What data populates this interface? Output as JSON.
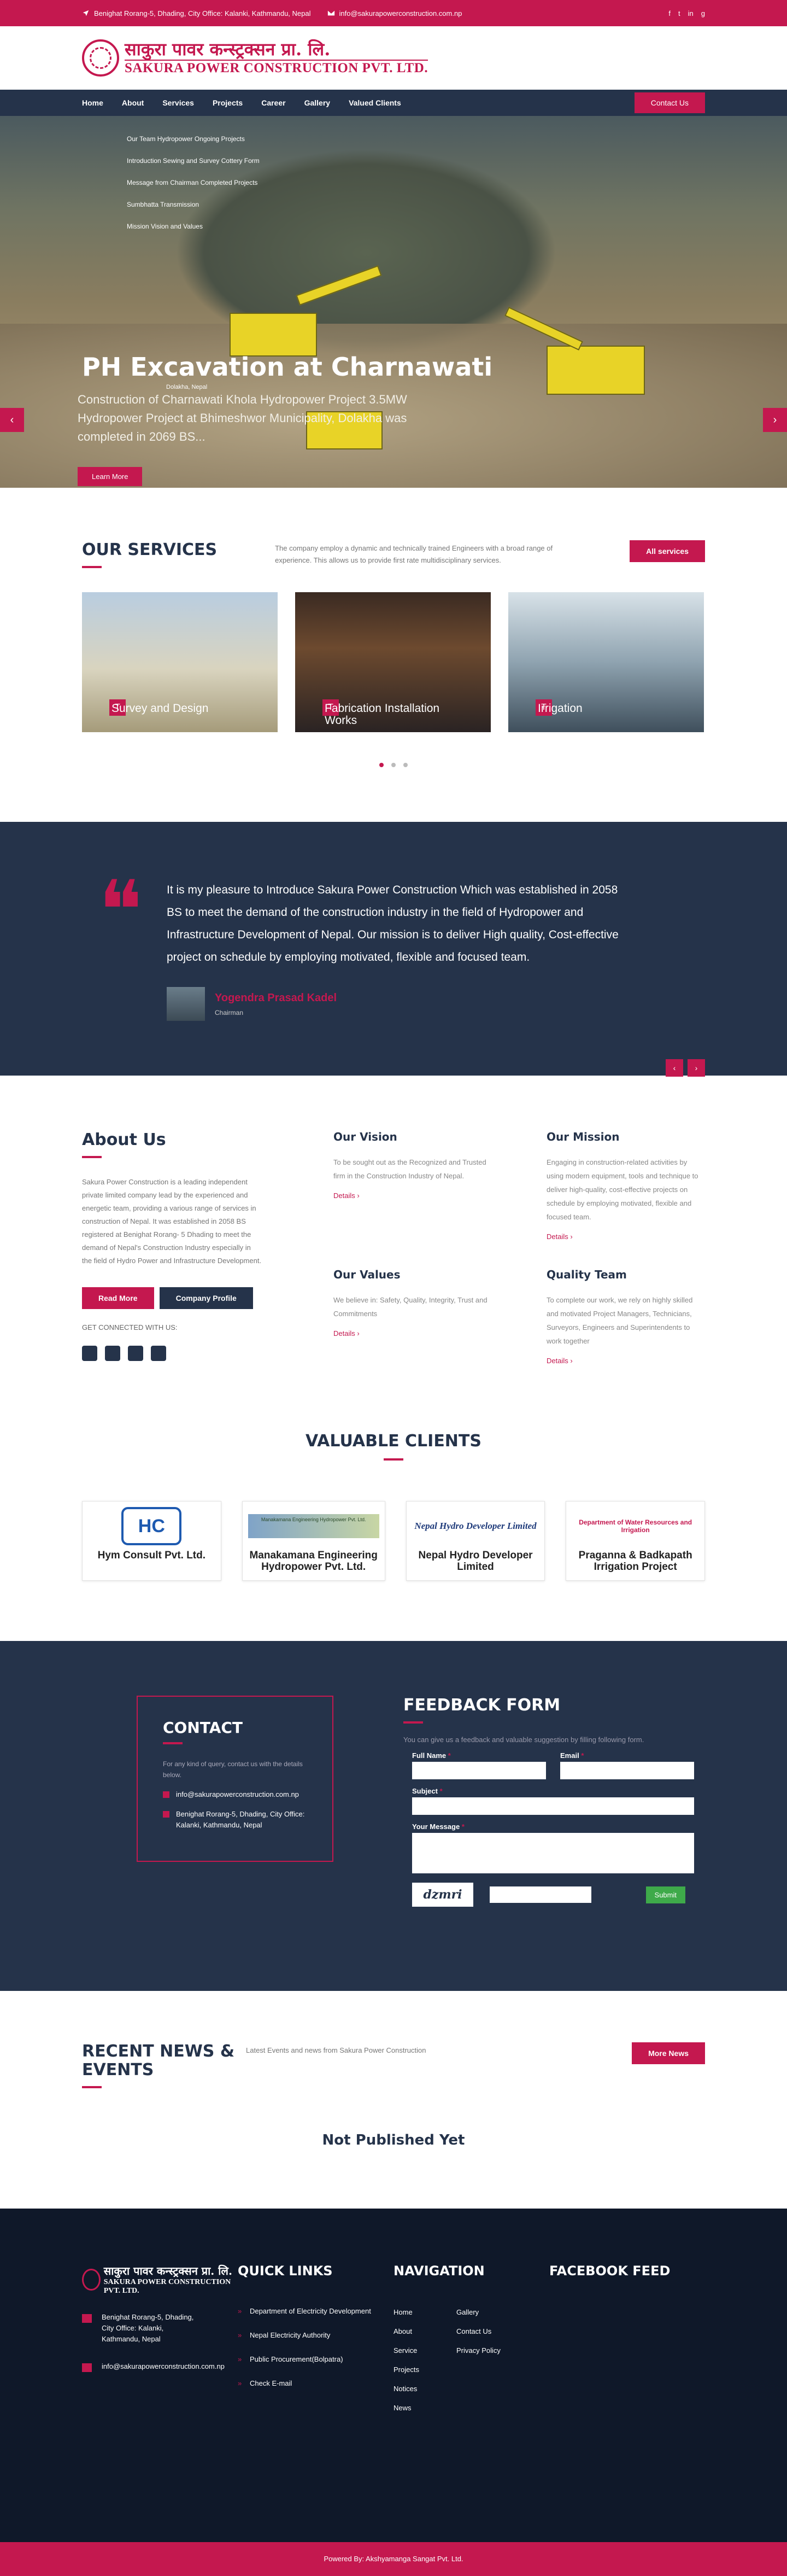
{
  "topbar": {
    "address": "Benighat Rorang-5, Dhading, City Office: Kalanki, Kathmandu, Nepal",
    "email": "info@sakurapowerconstruction.com.np",
    "social": [
      "f",
      "t",
      "in",
      "g"
    ]
  },
  "logo": {
    "nepali": "साकुरा पावर कन्स्ट्रक्सन प्रा. लि.",
    "english": "SAKURA POWER CONSTRUCTION PVT. LTD."
  },
  "nav": {
    "items": [
      "Home",
      "About",
      "Services",
      "Projects",
      "Career",
      "Gallery",
      "Valued Clients"
    ],
    "contact": "Contact Us"
  },
  "hero_menu": [
    "Our Team    Hydropower    Ongoing Projects",
    "Introduction Sewing and Survey    Cottery Form",
    "Message from Chairman    Completed Projects",
    "Sumbhatta    Transmission",
    "Mission Vision and Values"
  ],
  "hero": {
    "title": "PH Excavation at Charnawati",
    "subtitle_small": "Dolakha, Nepal",
    "text": "Construction of Charnawati Khola Hydropower Project 3.5MW Hydropower Project at Bhimeshwor Municipality, Dolakha was completed in 2069 BS...",
    "button": "Learn More"
  },
  "services": {
    "title": "OUR SERVICES",
    "desc": "The company employ a dynamic and technically trained Engineers with a broad range of experience. This allows us to provide first rate multidisciplinary services.",
    "button": "All services",
    "items": [
      {
        "label": "Survey and Design"
      },
      {
        "label": "Fabrication Installation Works"
      },
      {
        "label": "Irrigation"
      }
    ]
  },
  "quote": {
    "text": "It is my pleasure to Introduce Sakura Power Construction Which was established in 2058 BS to meet the demand of the construction industry in the field of Hydropower and Infrastructure Development of Nepal. Our mission is to deliver High quality, Cost-effective project on schedule by employing motivated, flexible and focused team.",
    "author": "Yogendra Prasad Kadel",
    "role": "Chairman"
  },
  "about": {
    "title": "About Us",
    "text": "Sakura Power Construction is a leading independent private limited company lead by the experienced and energetic team, providing a various range of services in construction of Nepal. It was established in 2058 BS registered at Benighat Rorang- 5 Dhading to meet the demand of Nepal's Construction Industry especially in the field of Hydro Power and Infrastructure Development.",
    "read_more": "Read More",
    "profile": "Company Profile",
    "connected": "GET CONNECTED WITH US:",
    "cols": [
      {
        "title": "Our Vision",
        "text": "To be sought out as the Recognized and Trusted firm in the Construction Industry of Nepal.",
        "link": "Details"
      },
      {
        "title": "Our Mission",
        "text": "Engaging in construction-related activities by using modern equipment, tools and technique to deliver high-quality, cost-effective projects on schedule by employing motivated, flexible and focused team.",
        "link": "Details"
      },
      {
        "title": "Our Values",
        "text": "We believe in: Safety, Quality, Integrity, Trust and Commitments",
        "link": "Details"
      },
      {
        "title": "Quality Team",
        "text": "To complete our work, we rely on highly skilled and motivated Project Managers, Technicians, Surveyors, Engineers and Superintendents to work together",
        "link": "Details"
      }
    ]
  },
  "clients": {
    "title": "VALUABLE CLIENTS",
    "items": [
      {
        "name": "Hym Consult Pvt. Ltd.",
        "logo": "HC"
      },
      {
        "name": "Manakamana Engineering Hydropower Pvt. Ltd.",
        "logo": "Manakamana Engineering Hydropower Pvt. Ltd."
      },
      {
        "name": "Nepal Hydro Developer Limited",
        "logo": "Nepal Hydro Developer Limited"
      },
      {
        "name": "Praganna & Badkapath Irrigation Project",
        "logo": "Department of Water Resources and Irrigation"
      }
    ]
  },
  "contact": {
    "title": "CONTACT",
    "desc": "For any kind of query, contact us with the details below.",
    "email": "info@sakurapowerconstruction.com.np",
    "address": "Benighat Rorang-5, Dhading, City Office: Kalanki, Kathmandu, Nepal"
  },
  "feedback": {
    "title": "FEEDBACK FORM",
    "desc": "You can give us a feedback and valuable suggestion by filling following form.",
    "full_name": "Full Name",
    "email": "Email",
    "subject": "Subject",
    "message": "Your Message",
    "captcha": "dzmri",
    "submit": "Submit"
  },
  "news": {
    "title": "RECENT NEWS & EVENTS",
    "desc": "Latest Events and news from Sakura Power Construction",
    "button": "More News",
    "empty": "Not Published Yet"
  },
  "footer": {
    "logo_np": "साकुरा पावर कन्स्ट्रक्सन प्रा. लि.",
    "logo_en": "SAKURA POWER CONSTRUCTION PVT. LTD.",
    "address": "Benighat Rorang-5, Dhading, City Office: Kalanki, Kathmandu, Nepal",
    "email": "info@sakurapowerconstruction.com.np",
    "quick_title": "QUICK LINKS",
    "quick": [
      "Department of Electricity Development",
      "Nepal Electricity Authority",
      "Public Procurement(Bolpatra)",
      "Check E-mail"
    ],
    "nav_title": "NAVIGATION",
    "nav_a": [
      "Home",
      "About",
      "Service",
      "Projects",
      "Notices",
      "News"
    ],
    "nav_b": [
      "Gallery",
      "Contact Us",
      "Privacy Policy"
    ],
    "fb_title": "FACEBOOK FEED"
  },
  "copyright": "Powered By: Akshyamanga Sangat Pvt. Ltd."
}
